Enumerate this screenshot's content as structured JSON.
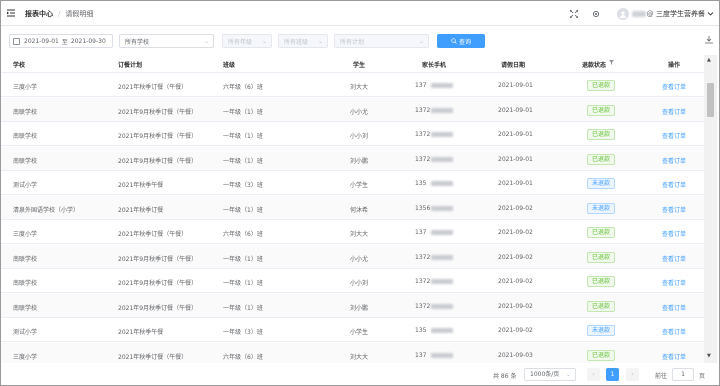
{
  "header": {
    "breadcrumb_1": "报表中心",
    "breadcrumb_sep": "/",
    "breadcrumb_2": "请假明细",
    "school_name": "三度学生营养餐"
  },
  "filters": {
    "date_start": "2021-09-01",
    "date_to": "至",
    "date_end": "2021-09-30",
    "school_select": "所有学校",
    "grade_select": "所有年级",
    "class_select": "所有班级",
    "plan_select": "所有计划",
    "search_label": "查询"
  },
  "table": {
    "columns": [
      "学校",
      "订餐计划",
      "班级",
      "学生",
      "家长手机",
      "请假日期",
      "退款状态",
      "操作"
    ],
    "rows": [
      {
        "school": "三度小学",
        "plan": "2021年秋季订餐（午餐）",
        "class": "六年级（6）班",
        "student": "刘大大",
        "phone": "137",
        "date": "2021-09-01",
        "status": "已退款",
        "status_type": "ok",
        "action": "查看订单"
      },
      {
        "school": "南联学校",
        "plan": "2021年9月秋季订餐（午餐）",
        "class": "一年级（1）班",
        "student": "小小尤",
        "phone": "1372",
        "date": "2021-09-01",
        "status": "已退款",
        "status_type": "ok",
        "action": "查看订单"
      },
      {
        "school": "南联学校",
        "plan": "2021年9月秋季订餐（午餐）",
        "class": "一年级（1）班",
        "student": "小小刘",
        "phone": "1372",
        "date": "2021-09-01",
        "status": "已退款",
        "status_type": "ok",
        "action": "查看订单"
      },
      {
        "school": "南联学校",
        "plan": "2021年9月秋季订餐（午餐）",
        "class": "一年级（1）班",
        "student": "刘小鹏",
        "phone": "1372",
        "date": "2021-09-01",
        "status": "已退款",
        "status_type": "ok",
        "action": "查看订单"
      },
      {
        "school": "测试小学",
        "plan": "2021年秋季午餐",
        "class": "一年级（3）班",
        "student": "小学生",
        "phone": "135",
        "date": "2021-09-01",
        "status": "未退款",
        "status_type": "no",
        "action": "查看订单"
      },
      {
        "school": "清泉外国语学校（小学）",
        "plan": "2021年秋季订餐",
        "class": "一年级（1）班",
        "student": "何沐希",
        "phone": "1356",
        "date": "2021-09-02",
        "status": "未退款",
        "status_type": "no",
        "action": "查看订单"
      },
      {
        "school": "三度小学",
        "plan": "2021年秋季订餐（午餐）",
        "class": "六年级（6）班",
        "student": "刘大大",
        "phone": "137",
        "date": "2021-09-02",
        "status": "已退款",
        "status_type": "ok",
        "action": "查看订单"
      },
      {
        "school": "南联学校",
        "plan": "2021年9月秋季订餐（午餐）",
        "class": "一年级（1）班",
        "student": "小小尤",
        "phone": "1372",
        "date": "2021-09-02",
        "status": "已退款",
        "status_type": "ok",
        "action": "查看订单"
      },
      {
        "school": "南联学校",
        "plan": "2021年9月秋季订餐（午餐）",
        "class": "一年级（1）班",
        "student": "小小刘",
        "phone": "1372",
        "date": "2021-09-02",
        "status": "已退款",
        "status_type": "ok",
        "action": "查看订单"
      },
      {
        "school": "南联学校",
        "plan": "2021年9月秋季订餐（午餐）",
        "class": "一年级（1）班",
        "student": "刘小鹏",
        "phone": "1372",
        "date": "2021-09-02",
        "status": "已退款",
        "status_type": "ok",
        "action": "查看订单"
      },
      {
        "school": "测试小学",
        "plan": "2021年秋季午餐",
        "class": "一年级（3）班",
        "student": "小学生",
        "phone": "135",
        "date": "2021-09-02",
        "status": "未退款",
        "status_type": "no",
        "action": "查看订单"
      },
      {
        "school": "三度小学",
        "plan": "2021年秋季订餐（午餐）",
        "class": "六年级（6）班",
        "student": "刘大大",
        "phone": "137",
        "date": "2021-09-03",
        "status": "已退款",
        "status_type": "ok",
        "action": "查看订单"
      }
    ]
  },
  "pagination": {
    "total": "共 86 条",
    "page_size": "1000条/页",
    "prev": "‹",
    "current": "1",
    "next": "›",
    "goto_label": "前往",
    "goto_value": "1",
    "page_label": "页"
  },
  "colors": {
    "accent": "#409eff",
    "success": "#67c23a"
  }
}
